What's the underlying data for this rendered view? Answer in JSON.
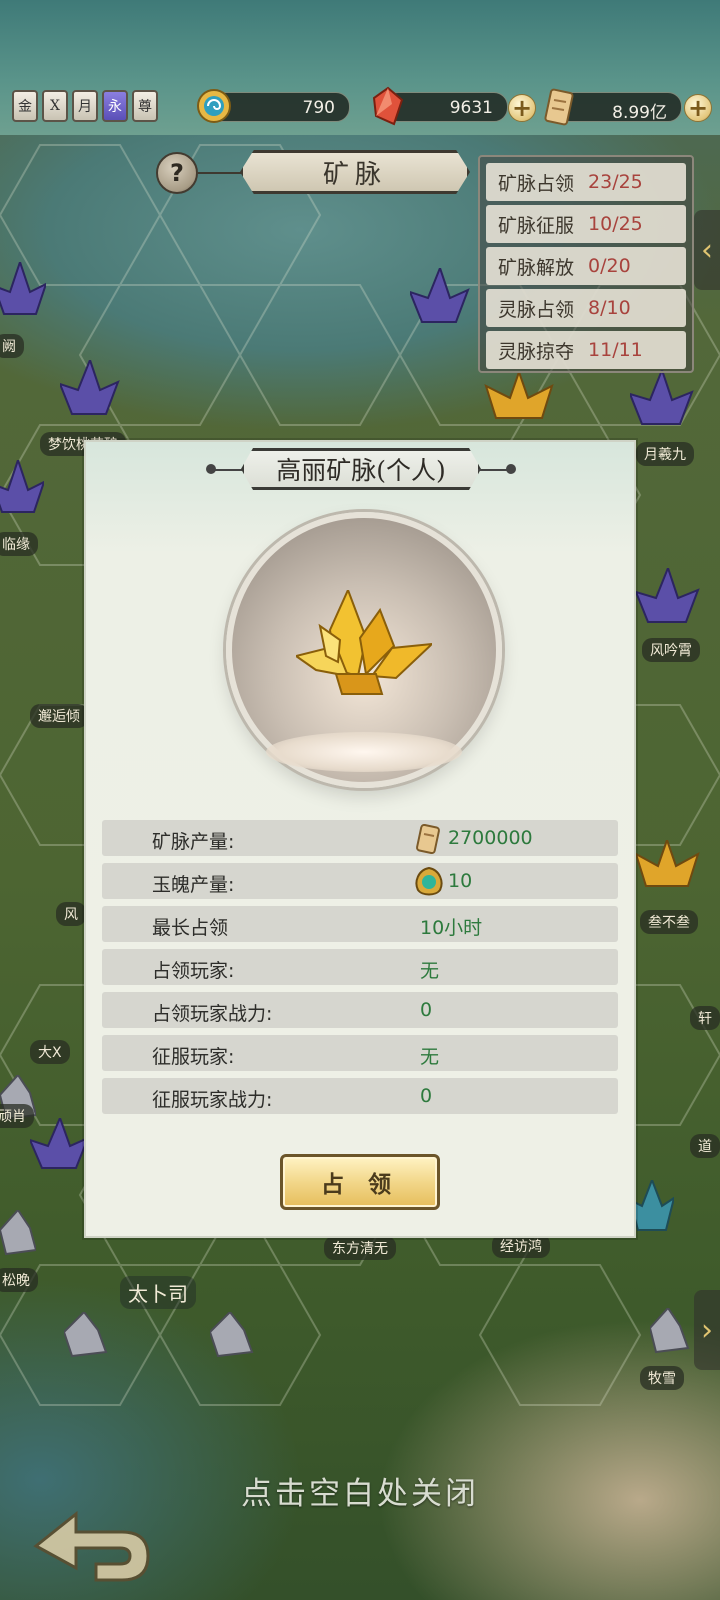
{
  "top_bar": {
    "badges": [
      "金",
      "X",
      "月",
      "永",
      "尊"
    ],
    "resources": [
      {
        "icon": "jade-swirl-icon",
        "value": "790"
      },
      {
        "icon": "red-crystal-icon",
        "value": "9631"
      },
      {
        "icon": "scroll-coin-icon",
        "value": "8.99亿"
      }
    ]
  },
  "header": {
    "help_label": "?",
    "title": "矿脉"
  },
  "stats_panel": {
    "rows": [
      {
        "label": "矿脉占领",
        "value": "23/25"
      },
      {
        "label": "矿脉征服",
        "value": "10/25"
      },
      {
        "label": "矿脉解放",
        "value": "0/20"
      },
      {
        "label": "灵脉占领",
        "value": "8/10"
      },
      {
        "label": "灵脉掠夺",
        "value": "11/11"
      }
    ]
  },
  "map_labels": [
    "阙",
    "梦饮桃花酿",
    "月羲九",
    "临缘",
    "风吟霄",
    "邂逅倾",
    "风",
    "叁不叁",
    "大X",
    "轩",
    "顽肖",
    "道",
    "松晚",
    "东方清无",
    "经访鸿",
    "太卜司",
    "牧雪"
  ],
  "modal": {
    "title": "高丽矿脉(个人)",
    "rows": [
      {
        "label": "矿脉产量:",
        "value": "2700000",
        "icon": "scroll-coin-icon"
      },
      {
        "label": "玉魄产量:",
        "value": "10",
        "icon": "jade-gem-icon"
      },
      {
        "label": "最长占领",
        "value": "10小时"
      },
      {
        "label": "占领玩家:",
        "value": "无"
      },
      {
        "label": "占领玩家战力:",
        "value": "0"
      },
      {
        "label": "征服玩家:",
        "value": "无"
      },
      {
        "label": "征服玩家战力:",
        "value": "0"
      }
    ],
    "occupy_button": "占 领"
  },
  "close_hint": "点击空白处关闭",
  "colors": {
    "stat_value": "#a8433d",
    "info_value": "#2d7a3d",
    "button_gold": "#f2d78a"
  }
}
